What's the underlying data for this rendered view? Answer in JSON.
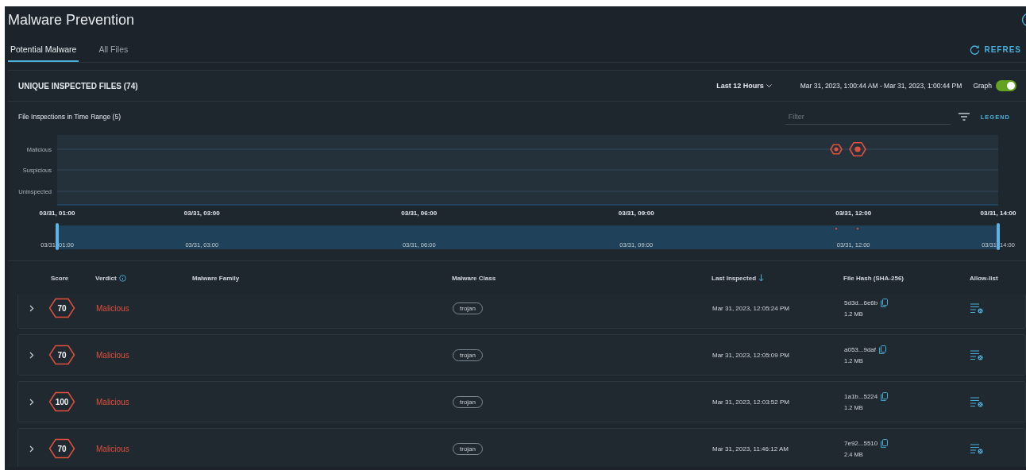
{
  "window": {
    "title": "Malware Prevention"
  },
  "tabs": [
    {
      "label": "Potential Malware",
      "selected": true
    },
    {
      "label": "All Files",
      "selected": false
    }
  ],
  "refresh": {
    "label": "REFRES"
  },
  "summary": {
    "title": "UNIQUE INSPECTED FILES (74)",
    "time_range": "Last 12 Hours",
    "date_range": "Mar 31, 2023, 1:00:44 AM - Mar 31, 2023, 1:00:44 PM",
    "graph_toggle": {
      "label": "Graph",
      "on": true
    }
  },
  "inspections": {
    "title": "File Inspections in Time Range (5)",
    "filter": {
      "placeholder": "Filter"
    },
    "legend": "LEGEND",
    "timeline": {
      "y_labels": [
        "Malicious",
        "Suspicious",
        "Uninspected"
      ],
      "x_labels": [
        "03/31, 01:00",
        "03/31, 03:00",
        "03/31, 06:00",
        "03/31, 09:00",
        "03/31, 12:00",
        "03/31, 14:00"
      ]
    },
    "navigator": {
      "labels": [
        "03/31, 01:00",
        "03/31, 03:00",
        "03/31, 06:00",
        "03/31, 09:00",
        "03/31, 12:00",
        "03/31, 14:00"
      ]
    }
  },
  "table": {
    "columns": [
      "Score",
      "Verdict",
      "Malware Family",
      "Malware Class",
      "Last Inspected",
      "File Hash (SHA-256)",
      "Allow-list"
    ],
    "rows": [
      {
        "expanded": false,
        "score": "70",
        "verdict": "Malicious",
        "malware_class": "trojan",
        "last_inspected": "Mar 31, 2023, 12:05:24 PM",
        "hash": "5d3d...6e6b",
        "size": "1.2 MB"
      },
      {
        "expanded": false,
        "score": "70",
        "verdict": "Malicious",
        "malware_class": "trojan",
        "last_inspected": "Mar 31, 2023, 12:05:09 PM",
        "hash": "a053...9daf",
        "size": "1.2 MB"
      },
      {
        "expanded": false,
        "score": "100",
        "verdict": "Malicious",
        "malware_class": "trojan",
        "last_inspected": "Mar 31, 2023, 12:03:52 PM",
        "hash": "1a1b...5224",
        "size": "1.2 MB"
      },
      {
        "expanded": false,
        "score": "70",
        "verdict": "Malicious",
        "malware_class": "trojan",
        "last_inspected": "Mar 31, 2023, 11:46:12 AM",
        "hash": "7e92...5510",
        "size": "2.4 MB"
      }
    ]
  }
}
